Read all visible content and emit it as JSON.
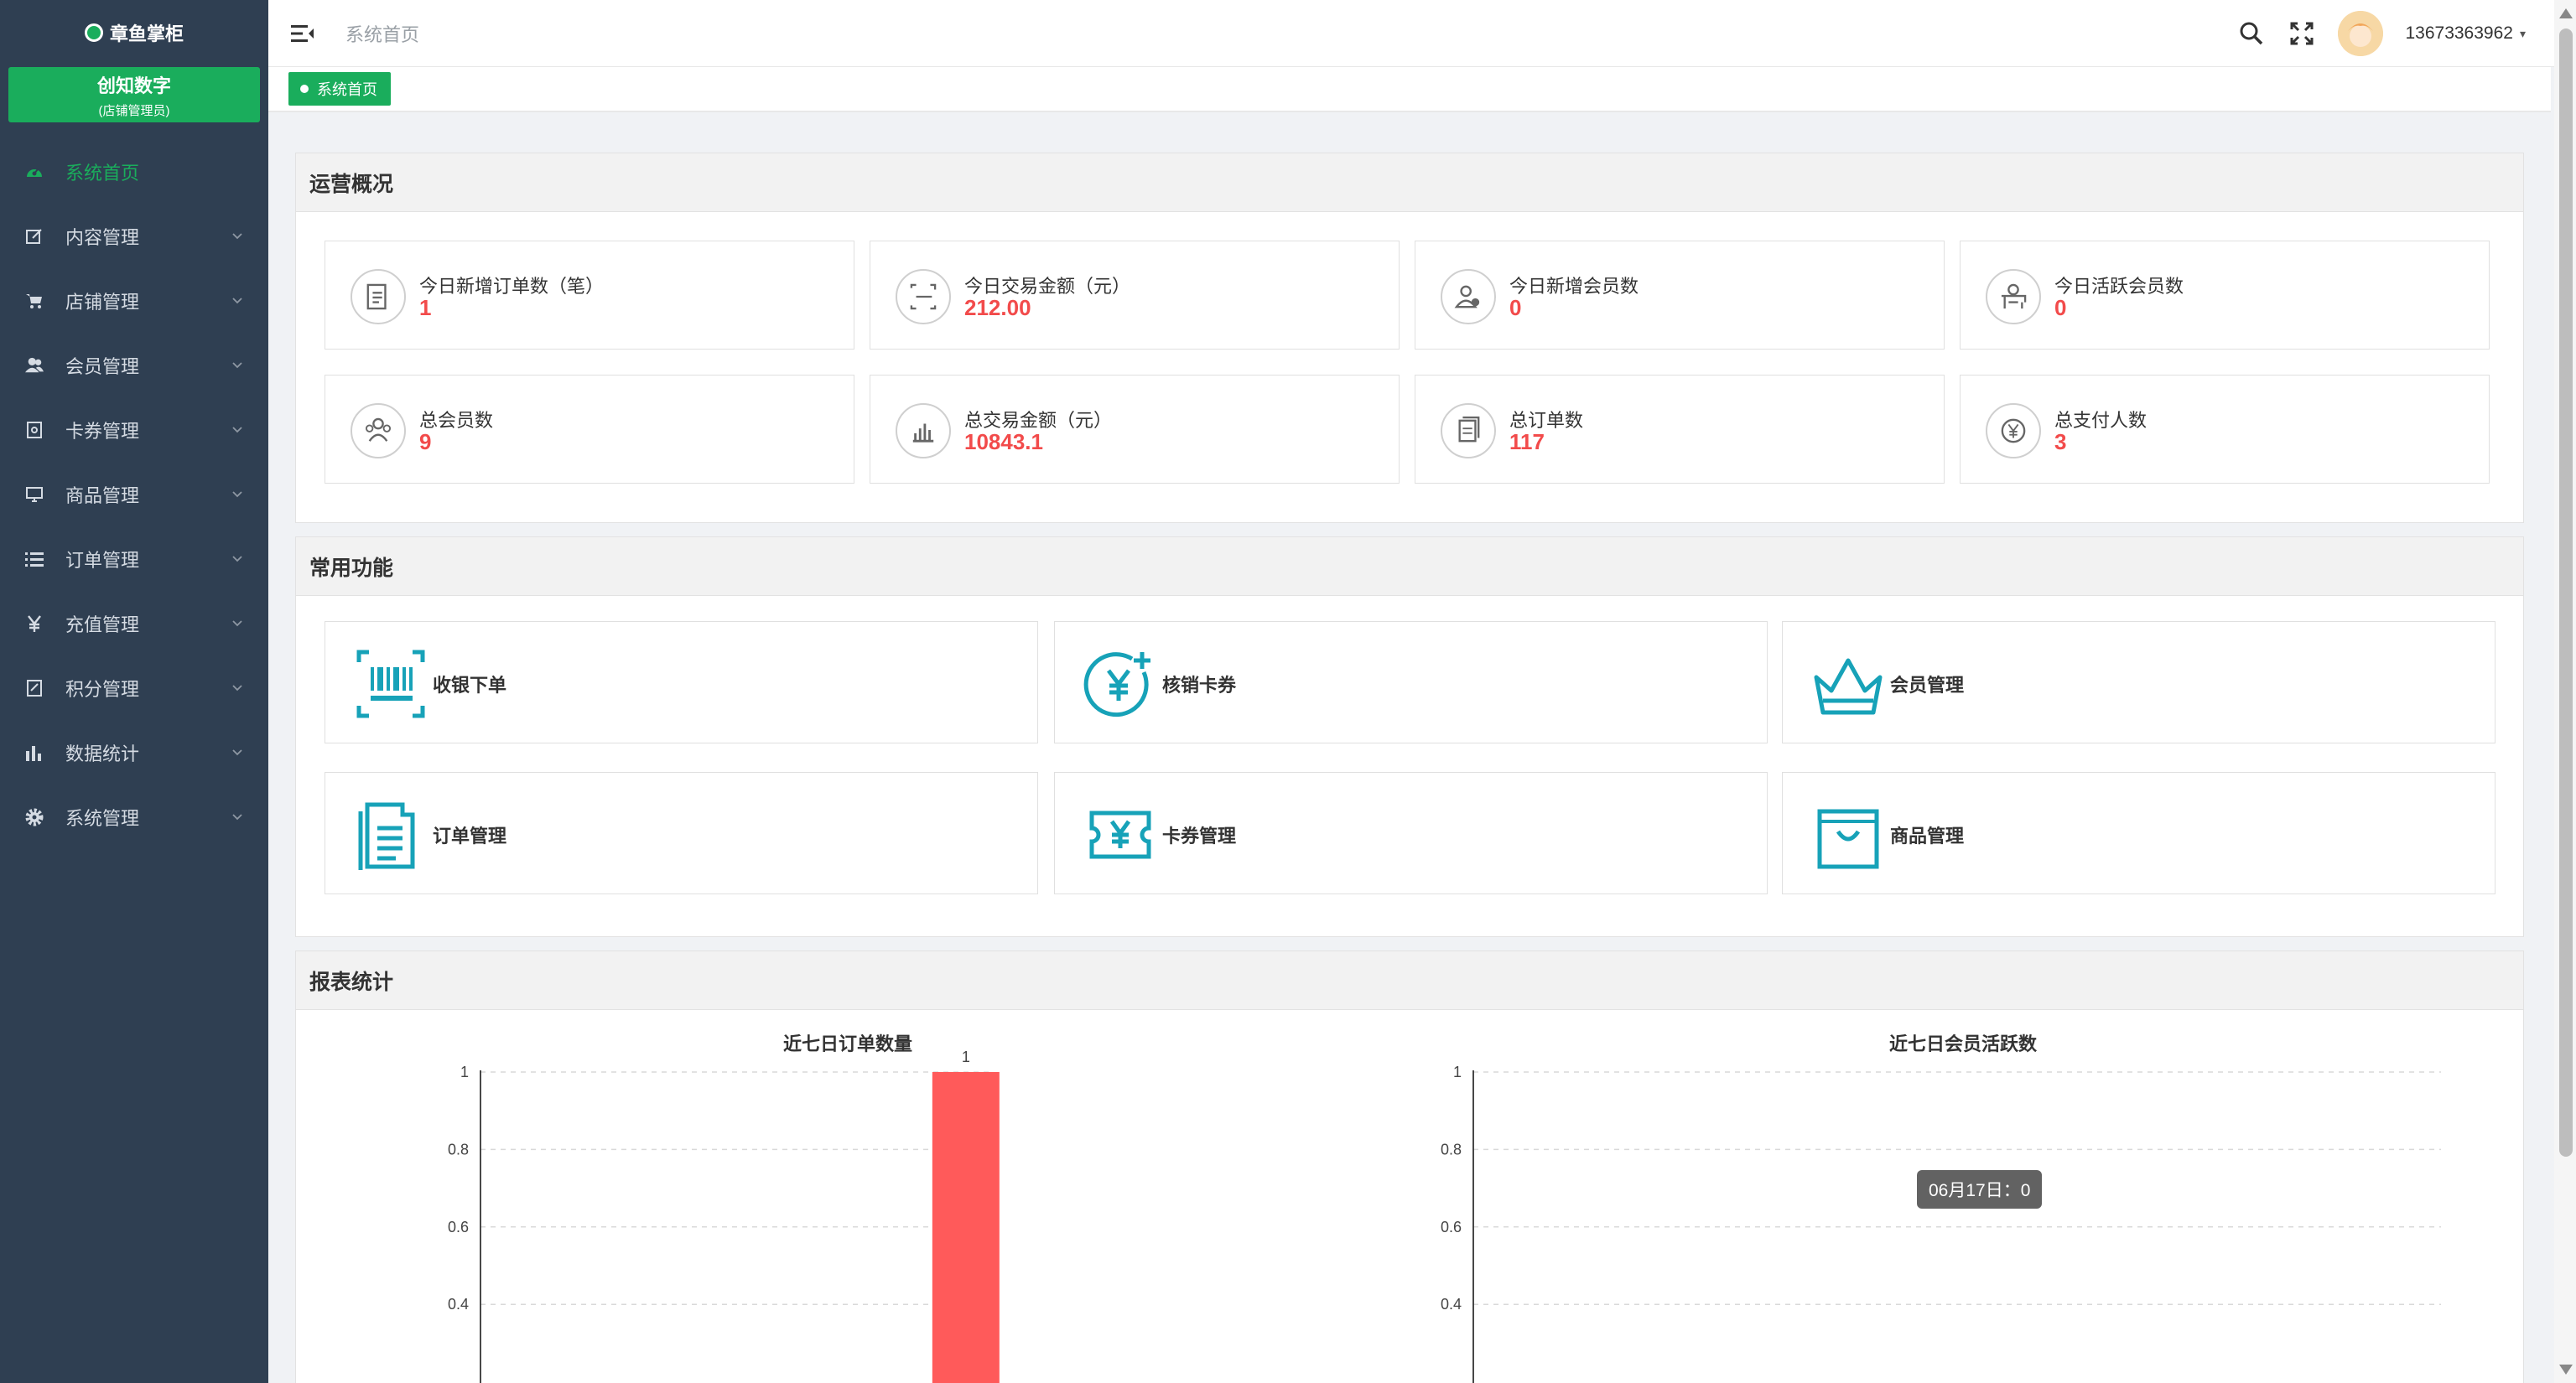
{
  "brand": {
    "logo_text": "章鱼掌柜",
    "store_name": "创知数字",
    "store_role": "(店铺管理员)"
  },
  "sidebar": {
    "items": [
      {
        "label": "系统首页",
        "icon": "dashboard-icon",
        "active": true
      },
      {
        "label": "内容管理",
        "icon": "edit-icon"
      },
      {
        "label": "店铺管理",
        "icon": "cart-icon"
      },
      {
        "label": "会员管理",
        "icon": "users-icon"
      },
      {
        "label": "卡券管理",
        "icon": "coupon-icon"
      },
      {
        "label": "商品管理",
        "icon": "monitor-icon"
      },
      {
        "label": "订单管理",
        "icon": "list-icon"
      },
      {
        "label": "充值管理",
        "icon": "yen-icon"
      },
      {
        "label": "积分管理",
        "icon": "points-icon"
      },
      {
        "label": "数据统计",
        "icon": "bar-chart-icon"
      },
      {
        "label": "系统管理",
        "icon": "gear-icon"
      }
    ]
  },
  "header": {
    "breadcrumb": "系统首页",
    "username": "13673363962",
    "caret": "▾"
  },
  "tabs": {
    "active": "系统首页"
  },
  "ops": {
    "title": "运营概况",
    "stats": [
      {
        "label": "今日新增订单数（笔）",
        "value": "1",
        "icon": "order-doc-icon"
      },
      {
        "label": "今日交易金额（元）",
        "value": "212.00",
        "icon": "scan-money-icon"
      },
      {
        "label": "今日新增会员数",
        "value": "0",
        "icon": "new-member-icon"
      },
      {
        "label": "今日活跃会员数",
        "value": "0",
        "icon": "active-member-icon"
      },
      {
        "label": "总会员数",
        "value": "9",
        "icon": "members-group-icon"
      },
      {
        "label": "总交易金额（元）",
        "value": "10843.1",
        "icon": "bar-growth-icon"
      },
      {
        "label": "总订单数",
        "value": "117",
        "icon": "orders-stack-icon"
      },
      {
        "label": "总支付人数",
        "value": "3",
        "icon": "yen-circle-icon"
      }
    ]
  },
  "functions": {
    "title": "常用功能",
    "items": [
      {
        "label": "收银下单",
        "icon": "barcode-scan-icon"
      },
      {
        "label": "核销卡券",
        "icon": "yen-plus-icon"
      },
      {
        "label": "会员管理",
        "icon": "crown-icon"
      },
      {
        "label": "订单管理",
        "icon": "document-list-icon"
      },
      {
        "label": "卡券管理",
        "icon": "ticket-yen-icon"
      },
      {
        "label": "商品管理",
        "icon": "shopping-bag-icon"
      }
    ]
  },
  "report": {
    "title": "报表统计",
    "tooltip": "06月17日：0"
  },
  "colors": {
    "brand": "#1aad5c",
    "sidebar_bg": "#2f3f52",
    "value_red": "#f24b4b",
    "icon_teal": "#17a2b8",
    "bar_red": "#ff5a5a"
  },
  "chart_data": [
    {
      "type": "bar",
      "title": "近七日订单数量",
      "categories": [
        "",
        "",
        "",
        "",
        "",
        "",
        ""
      ],
      "values": [
        0,
        0,
        0,
        0,
        0,
        0,
        1
      ],
      "data_labels": [
        "",
        "",
        "",
        "",
        "",
        "",
        "1"
      ],
      "ylim": [
        0,
        1
      ],
      "yticks": [
        "1",
        "0.8",
        "0.6",
        "0.4"
      ],
      "grid": true
    },
    {
      "type": "line",
      "title": "近七日会员活跃数",
      "categories": [
        "",
        "",
        "",
        "",
        "",
        "",
        ""
      ],
      "values": [
        0,
        0,
        0,
        0,
        0,
        0,
        0
      ],
      "ylim": [
        0,
        1
      ],
      "yticks": [
        "1",
        "0.8",
        "0.6",
        "0.4"
      ],
      "grid": true
    }
  ]
}
